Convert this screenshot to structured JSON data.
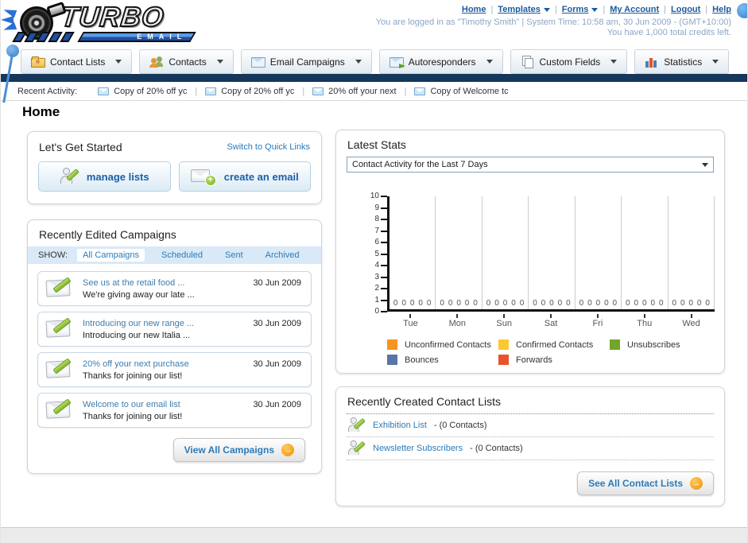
{
  "page": {
    "title": "Home"
  },
  "header": {
    "logo": {
      "brand": "TURBO",
      "sub": "EMAIL"
    },
    "nav": [
      {
        "label": "Home",
        "dropdown": false
      },
      {
        "label": "Templates",
        "dropdown": true
      },
      {
        "label": "Forms",
        "dropdown": true
      },
      {
        "label": "My Account",
        "dropdown": false
      },
      {
        "label": "Logout",
        "dropdown": false
      },
      {
        "label": "Help",
        "dropdown": false
      }
    ],
    "login_text": "You are logged in as \"Timothy Smith\" | System Time: 10:58 am, 30 Jun 2009 - (GMT+10:00)",
    "credits_text": "You have 1,000 total credits left."
  },
  "tabs": [
    {
      "label": "Contact Lists",
      "icon": "contact-lists-folder-icon"
    },
    {
      "label": "Contacts",
      "icon": "contacts-people-icon"
    },
    {
      "label": "Email Campaigns",
      "icon": "email-campaigns-envelope-icon"
    },
    {
      "label": "Autoresponders",
      "icon": "autoresponders-envelope-icon"
    },
    {
      "label": "Custom Fields",
      "icon": "custom-fields-pages-icon"
    },
    {
      "label": "Statistics",
      "icon": "statistics-chart-icon"
    }
  ],
  "activity": {
    "label": "Recent Activity:",
    "items": [
      "Copy of 20% off yc",
      "Copy of 20% off yc",
      "20% off your next",
      "Copy of Welcome tc"
    ]
  },
  "get_started": {
    "title": "Let's Get Started",
    "switch_link": "Switch to Quick Links",
    "buttons": [
      {
        "label": "manage lists",
        "icon": "person-pencil-icon"
      },
      {
        "label": "create an email",
        "icon": "envelope-plus-icon"
      }
    ]
  },
  "campaigns": {
    "title": "Recently Edited Campaigns",
    "show_label": "SHOW:",
    "filters": [
      {
        "label": "All Campaigns",
        "active": true
      },
      {
        "label": "Scheduled",
        "active": false
      },
      {
        "label": "Sent",
        "active": false
      },
      {
        "label": "Archived",
        "active": false
      }
    ],
    "items": [
      {
        "title": "See us at the retail food ...",
        "subtitle": "We're giving away our late ...",
        "date": "30 Jun 2009"
      },
      {
        "title": "Introducing our new range ...",
        "subtitle": "Introducing our new Italia ...",
        "date": "30 Jun 2009"
      },
      {
        "title": "20% off your next purchase",
        "subtitle": "Thanks for joining our list!",
        "date": "30 Jun 2009"
      },
      {
        "title": "Welcome to our email list",
        "subtitle": "Thanks for joining our list!",
        "date": "30 Jun 2009"
      }
    ],
    "view_all_label": "View All Campaigns"
  },
  "stats": {
    "title": "Latest Stats",
    "dropdown_value": "Contact Activity for the Last 7 Days"
  },
  "chart_data": {
    "type": "bar",
    "title": "Contact Activity for the Last 7 Days",
    "categories": [
      "Tue",
      "Mon",
      "Sun",
      "Sat",
      "Fri",
      "Thu",
      "Wed"
    ],
    "series": [
      {
        "name": "Unconfirmed Contacts",
        "color": "#f7941e",
        "values": [
          0,
          0,
          0,
          0,
          0,
          0,
          0
        ]
      },
      {
        "name": "Confirmed Contacts",
        "color": "#fdc72f",
        "values": [
          0,
          0,
          0,
          0,
          0,
          0,
          0
        ]
      },
      {
        "name": "Unsubscribes",
        "color": "#70a62a",
        "values": [
          0,
          0,
          0,
          0,
          0,
          0,
          0
        ]
      },
      {
        "name": "Bounces",
        "color": "#5874a8",
        "values": [
          0,
          0,
          0,
          0,
          0,
          0,
          0
        ]
      },
      {
        "name": "Forwards",
        "color": "#e8532c",
        "values": [
          0,
          0,
          0,
          0,
          0,
          0,
          0
        ]
      }
    ],
    "ylim": [
      0,
      10
    ],
    "yticks": [
      10,
      9,
      8,
      7,
      6,
      5,
      4,
      3,
      2,
      1,
      0
    ],
    "grid": "vertical",
    "legend_position": "bottom",
    "value_labels": "every series shows 0 above the baseline in every category"
  },
  "contact_lists": {
    "title": "Recently Created Contact Lists",
    "items": [
      {
        "name": "Exhibition List",
        "count_text": "- (0 Contacts)"
      },
      {
        "name": "Newsletter Subscribers",
        "count_text": "- (0 Contacts)"
      }
    ],
    "see_all_label": "See All Contact Lists"
  },
  "colors": {
    "navy_bar": "#16375c",
    "link_blue": "#1b5a9e",
    "section_link_blue": "#2b7bb9",
    "accent_orange": "#f09204",
    "filter_bar_bg": "#d9e9f7"
  }
}
